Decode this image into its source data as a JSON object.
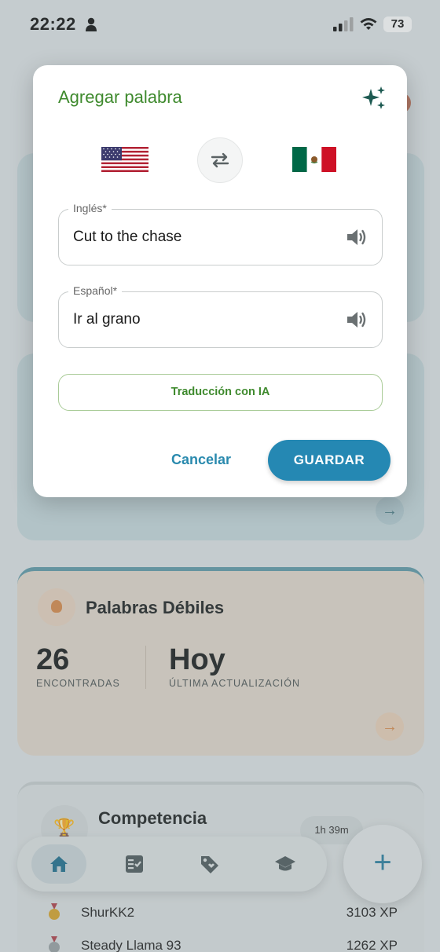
{
  "status_bar": {
    "time": "22:22",
    "battery": "73"
  },
  "dialog": {
    "title": "Agregar palabra",
    "source_field": {
      "label": "Inglés*",
      "value": "Cut to the chase"
    },
    "target_field": {
      "label": "Español*",
      "value": "Ir al grano"
    },
    "ai_button_label": "Traducción con IA",
    "cancel_label": "Cancelar",
    "save_label": "GUARDAR"
  },
  "weak_words": {
    "title": "Palabras Débiles",
    "found_count": "26",
    "found_label": "ENCONTRADAS",
    "updated_value": "Hoy",
    "updated_label": "ÚLTIMA ACTUALIZACIÓN"
  },
  "competition": {
    "title": "Competencia",
    "timer": "1h 39m",
    "ranking": [
      {
        "name": "ShurKK2",
        "xp": "3103 XP"
      },
      {
        "name": "Steady Llama 93",
        "xp": "1262 XP"
      }
    ]
  },
  "nav": {
    "items": [
      "home-icon",
      "checklist-icon",
      "tag-icon",
      "graduation-cap-icon"
    ],
    "fab_icon": "plus-icon"
  },
  "colors": {
    "accent_green": "#3f8a2e",
    "accent_blue": "#2588b3"
  }
}
